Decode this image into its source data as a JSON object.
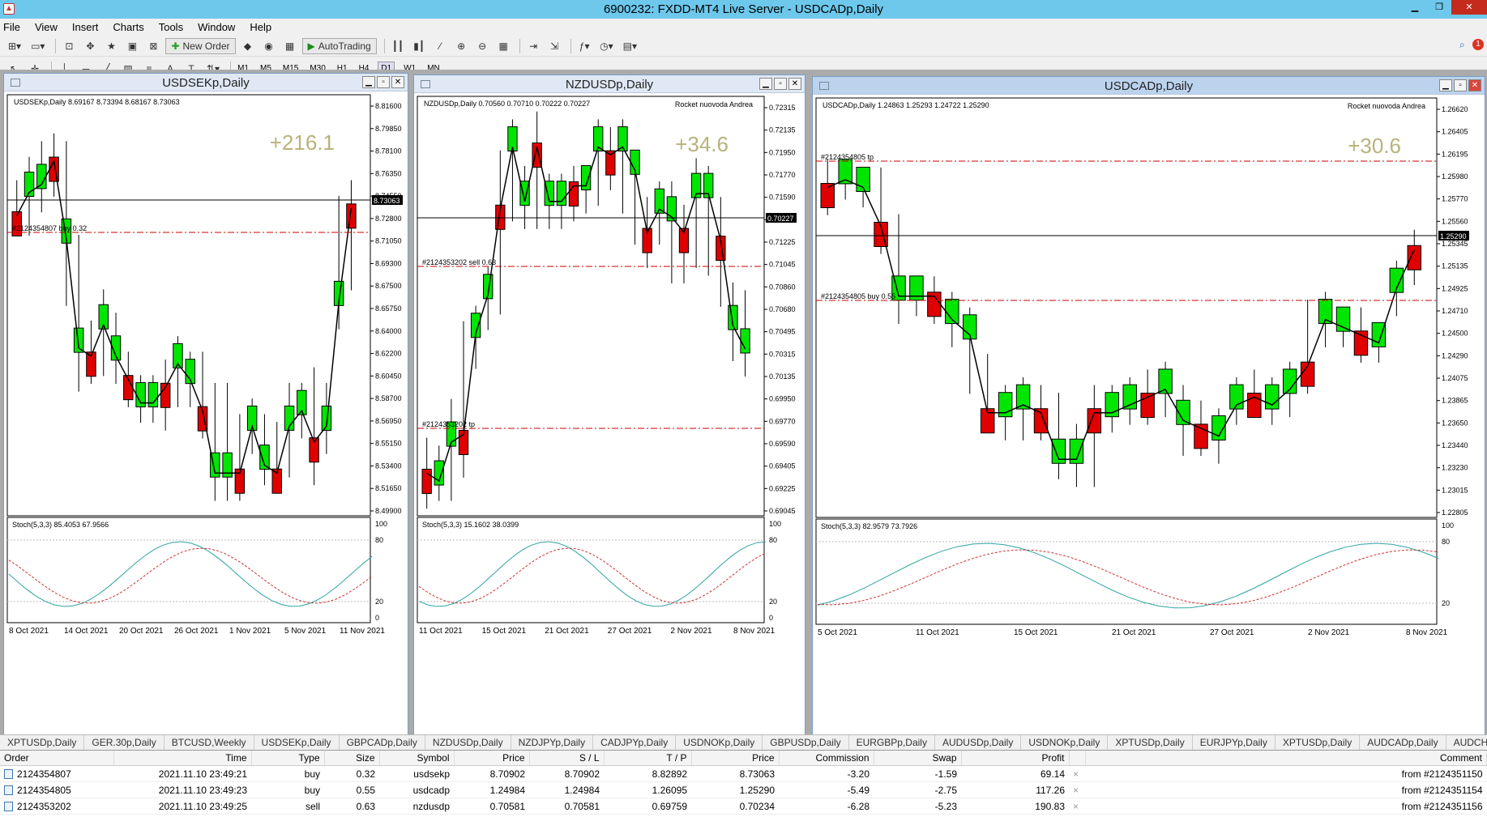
{
  "window": {
    "title": "6900232: FXDD-MT4 Live Server - USDCADp,Daily"
  },
  "menu": [
    "File",
    "View",
    "Insert",
    "Charts",
    "Tools",
    "Window",
    "Help"
  ],
  "toolbar": {
    "new_order": "New Order",
    "autotrading": "AutoTrading",
    "notification_count": "1"
  },
  "timeframes": [
    "M1",
    "M5",
    "M15",
    "M30",
    "H1",
    "H4",
    "D1",
    "W1",
    "MN"
  ],
  "active_timeframe": "D1",
  "charts": [
    {
      "window_title": "USDSEKp,Daily",
      "header": "USDSEKp,Daily  8.69167 8.73394 8.68167 8.73063",
      "profit": "+216.1",
      "price_label": "8.73063",
      "order_line": "#2124354807 buy 0.32",
      "stoch": "Stoch(5,3,3) 85.4053 67.9566",
      "rocket": "",
      "y_ticks": [
        "8.81600",
        "8.79850",
        "8.78100",
        "8.76350",
        "8.74550",
        "8.72800",
        "8.71050",
        "8.69300",
        "8.67500",
        "8.65750",
        "8.64000",
        "8.62200",
        "8.60450",
        "8.58700",
        "8.56950",
        "8.55150",
        "8.53400",
        "8.51650",
        "8.49900"
      ],
      "x_ticks": [
        "8 Oct 2021",
        "14 Oct 2021",
        "20 Oct 2021",
        "26 Oct 2021",
        "1 Nov 2021",
        "5 Nov 2021",
        "11 Nov 2021"
      ],
      "stoch_ticks": [
        "100",
        "80",
        "20",
        "0"
      ]
    },
    {
      "window_title": "NZDUSDp,Daily",
      "header": "NZDUSDp,Daily  0.70560 0.70710 0.70222 0.70227",
      "profit": "+34.6",
      "price_label": "0.70227",
      "order_line": "#2124353202 sell 0.63",
      "tp_line": "#2124353202 tp",
      "stoch": "Stoch(5,3,3) 15.1602 38.0399",
      "rocket": "Rocket nuovoda Andrea",
      "y_ticks": [
        "0.72315",
        "0.72135",
        "0.71950",
        "0.71770",
        "0.71590",
        "0.71405",
        "0.71225",
        "0.71045",
        "0.70860",
        "0.70680",
        "0.70495",
        "0.70315",
        "0.70135",
        "0.69950",
        "0.69770",
        "0.69590",
        "0.69405",
        "0.69225",
        "0.69045"
      ],
      "x_ticks": [
        "11 Oct 2021",
        "15 Oct 2021",
        "21 Oct 2021",
        "27 Oct 2021",
        "2 Nov 2021",
        "8 Nov 2021"
      ],
      "stoch_ticks": [
        "100",
        "80",
        "20",
        "0"
      ]
    },
    {
      "window_title": "USDCADp,Daily",
      "header": "USDCADp,Daily  1.24863 1.25293 1.24722 1.25290",
      "profit": "+30.6",
      "price_label": "1.25290",
      "order_line": "#2124354805 buy 0.55",
      "tp_line": "#2124354805 tp",
      "stoch": "Stoch(5,3,3) 82.9579 73.7926",
      "rocket": "Rocket nuovoda Andrea",
      "y_ticks": [
        "1.26620",
        "1.26405",
        "1.26195",
        "1.25980",
        "1.25770",
        "1.25560",
        "1.25345",
        "1.25135",
        "1.24925",
        "1.24710",
        "1.24500",
        "1.24290",
        "1.24075",
        "1.23865",
        "1.23650",
        "1.23440",
        "1.23230",
        "1.23015",
        "1.22805"
      ],
      "x_ticks": [
        "5 Oct 2021",
        "11 Oct 2021",
        "15 Oct 2021",
        "21 Oct 2021",
        "27 Oct 2021",
        "2 Nov 2021",
        "8 Nov 2021"
      ],
      "stoch_ticks": [
        "100",
        "80",
        "20"
      ]
    }
  ],
  "symbol_tabs": [
    "XPTUSDp,Daily",
    "GER.30p,Daily",
    "BTCUSD,Weekly",
    "USDSEKp,Daily",
    "GBPCADp,Daily",
    "NZDUSDp,Daily",
    "NZDJPYp,Daily",
    "CADJPYp,Daily",
    "USDNOKp,Daily",
    "GBPUSDp,Daily",
    "EURGBPp,Daily",
    "AUDUSDp,Daily",
    "USDNOKp,Daily",
    "XPTUSDp,Daily",
    "EURJPYp,Daily",
    "XPTUSDp,Daily",
    "AUDCADp,Daily",
    "AUDCHFp"
  ],
  "orders_table": {
    "columns": [
      "Order",
      "Time",
      "Type",
      "Size",
      "Symbol",
      "Price",
      "S / L",
      "T / P",
      "Price",
      "Commission",
      "Swap",
      "Profit",
      "",
      "Comment"
    ],
    "rows": [
      [
        "2124354807",
        "2021.11.10 23:49:21",
        "buy",
        "0.32",
        "usdsekp",
        "8.70902",
        "8.70902",
        "8.82892",
        "8.73063",
        "-3.20",
        "-1.59",
        "69.14",
        "×",
        "from #2124351150"
      ],
      [
        "2124354805",
        "2021.11.10 23:49:23",
        "buy",
        "0.55",
        "usdcadp",
        "1.24984",
        "1.24984",
        "1.26095",
        "1.25290",
        "-5.49",
        "-2.75",
        "117.26",
        "×",
        "from #2124351154"
      ],
      [
        "2124353202",
        "2021.11.10 23:49:25",
        "sell",
        "0.63",
        "nzdusdp",
        "0.70581",
        "0.70581",
        "0.69759",
        "0.70234",
        "-6.28",
        "-5.23",
        "190.83",
        "×",
        "from #2124351156"
      ]
    ]
  }
}
